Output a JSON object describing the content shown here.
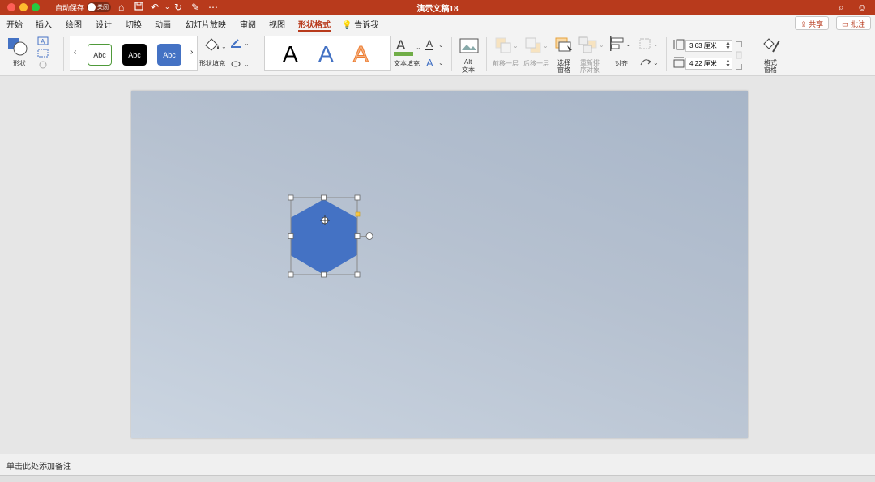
{
  "titlebar": {
    "autosave_label": "自动保存",
    "autosave_state": "关闭",
    "document_title": "演示文稿18"
  },
  "tabs": [
    {
      "label": "开始"
    },
    {
      "label": "插入"
    },
    {
      "label": "绘图"
    },
    {
      "label": "设计"
    },
    {
      "label": "切换"
    },
    {
      "label": "动画"
    },
    {
      "label": "幻灯片放映"
    },
    {
      "label": "审阅"
    },
    {
      "label": "视图"
    },
    {
      "label": "形状格式",
      "active": true
    }
  ],
  "tell_me": "告诉我",
  "share_label": "共享",
  "comments_label": "批注",
  "ribbon": {
    "shapes_label": "形状",
    "style_samples": [
      "Abc",
      "Abc",
      "Abc"
    ],
    "shape_fill_label": "形状填充",
    "wordart_letter": "A",
    "text_fill_label": "文本填充",
    "alt_text_label_1": "Alt",
    "alt_text_label_2": "文本",
    "bring_forward_label": "前移一层",
    "send_backward_label": "后移一层",
    "selection_pane_label_1": "选择",
    "selection_pane_label_2": "窗格",
    "reorder_label_1": "重新排",
    "reorder_label_2": "序对象",
    "align_label": "对齐",
    "height_value": "3.63 厘米",
    "width_value": "4.22 厘米",
    "format_pane_label_1": "格式",
    "format_pane_label_2": "窗格"
  },
  "colors": {
    "brand": "#b83a1c",
    "shape_fill": "#4472c4",
    "text_fill_bar": "#70ad47"
  },
  "notes_placeholder": "单击此处添加备注"
}
